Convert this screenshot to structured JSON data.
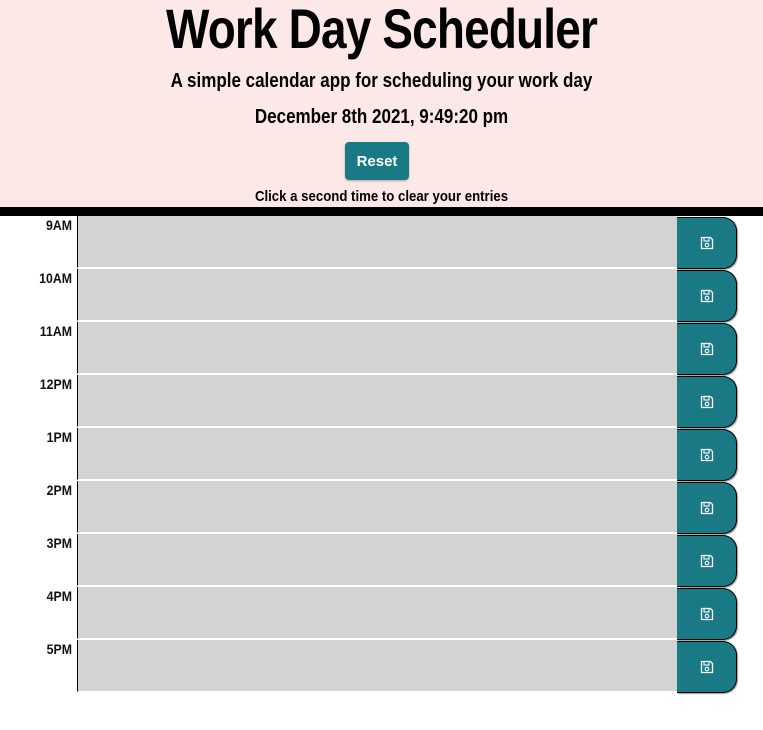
{
  "header": {
    "title": "Work Day Scheduler",
    "lead": "A simple calendar app for scheduling your work day",
    "current_datetime": "December 8th 2021, 9:49:20 pm",
    "reset_label": "Reset",
    "reset_hint": "Click a second time to clear your entries"
  },
  "schedule": {
    "rows": [
      {
        "hour": "9AM",
        "entry": ""
      },
      {
        "hour": "10AM",
        "entry": ""
      },
      {
        "hour": "11AM",
        "entry": ""
      },
      {
        "hour": "12PM",
        "entry": ""
      },
      {
        "hour": "1PM",
        "entry": ""
      },
      {
        "hour": "2PM",
        "entry": ""
      },
      {
        "hour": "3PM",
        "entry": ""
      },
      {
        "hour": "4PM",
        "entry": ""
      },
      {
        "hour": "5PM",
        "entry": ""
      }
    ],
    "save_icon": "floppy-disk-icon"
  },
  "colors": {
    "header_bg": "#fde8e8",
    "accent": "#197a86",
    "past_block": "#d3d3d3"
  }
}
